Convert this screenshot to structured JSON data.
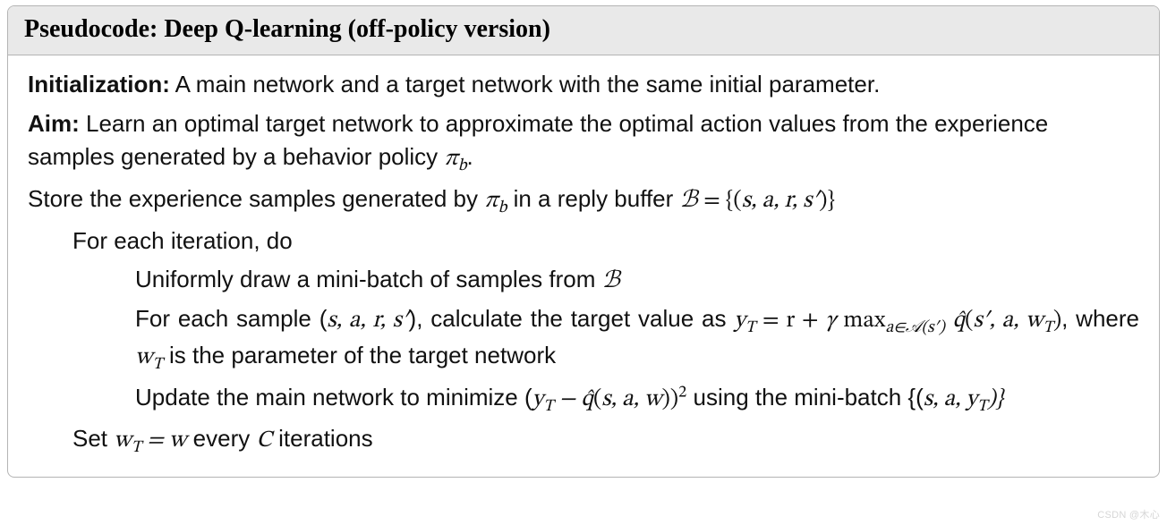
{
  "header": {
    "title": "Pseudocode: Deep Q-learning (off-policy version)"
  },
  "body": {
    "init_label": "Initialization:",
    "init_text": " A main network and a target network with the same initial parameter.",
    "aim_label": "Aim:",
    "aim_text": " Learn an optimal target network to approximate the optimal action values from the experience samples generated by a behavior policy ",
    "aim_math_pi_b": "π",
    "aim_math_pi_b_sub": "b",
    "period": ".",
    "store_pre": "Store the experience samples generated by ",
    "store_mid": " in a reply buffer ",
    "buffer_sym": "ℬ",
    "buffer_def_open": " = {(",
    "buffer_def_sars": "s, a, r, s′",
    "buffer_def_close": ")}",
    "for_each_iter": "For each iteration, do",
    "draw_line_pre": "Uniformly draw a mini-batch of samples from ",
    "sample_line_pre": "For each sample (",
    "sample_tuple": "s, a, r, s′",
    "sample_line_mid": "), calculate the target value as ",
    "yT": "y",
    "yT_sub": "T",
    "eq_r_plus": " = r + ",
    "gamma": "γ",
    "max_txt": " max",
    "max_sub_pre": "a∈",
    "calA": "𝒜",
    "max_sub_post": "(s′)",
    "space": " ",
    "qhat": "q̂",
    "qhat_args1_open": "(",
    "qhat_args1": "s′, a, w",
    "qhat_args1_subT": "T",
    "qhat_args1_close": ")",
    "where_pre": ", where ",
    "w": "w",
    "wT_sub": "T",
    "where_post": " is the parameter of the target network",
    "update_pre": "Update the main network to minimize (",
    "minus": " − ",
    "qhat_args2_open": "(",
    "qhat_args2": "s, a, w",
    "qhat_args2_close": "))",
    "sq": "2",
    "update_post": " using the mini-batch {(",
    "mini_tuple": "s, a, y",
    "mini_tuple_sub": "T",
    "update_close": ")}",
    "set_pre": "Set ",
    "set_eq": " = ",
    "set_mid": " every ",
    "C": "C",
    "set_post": " iterations"
  },
  "watermark": "CSDN @木心"
}
